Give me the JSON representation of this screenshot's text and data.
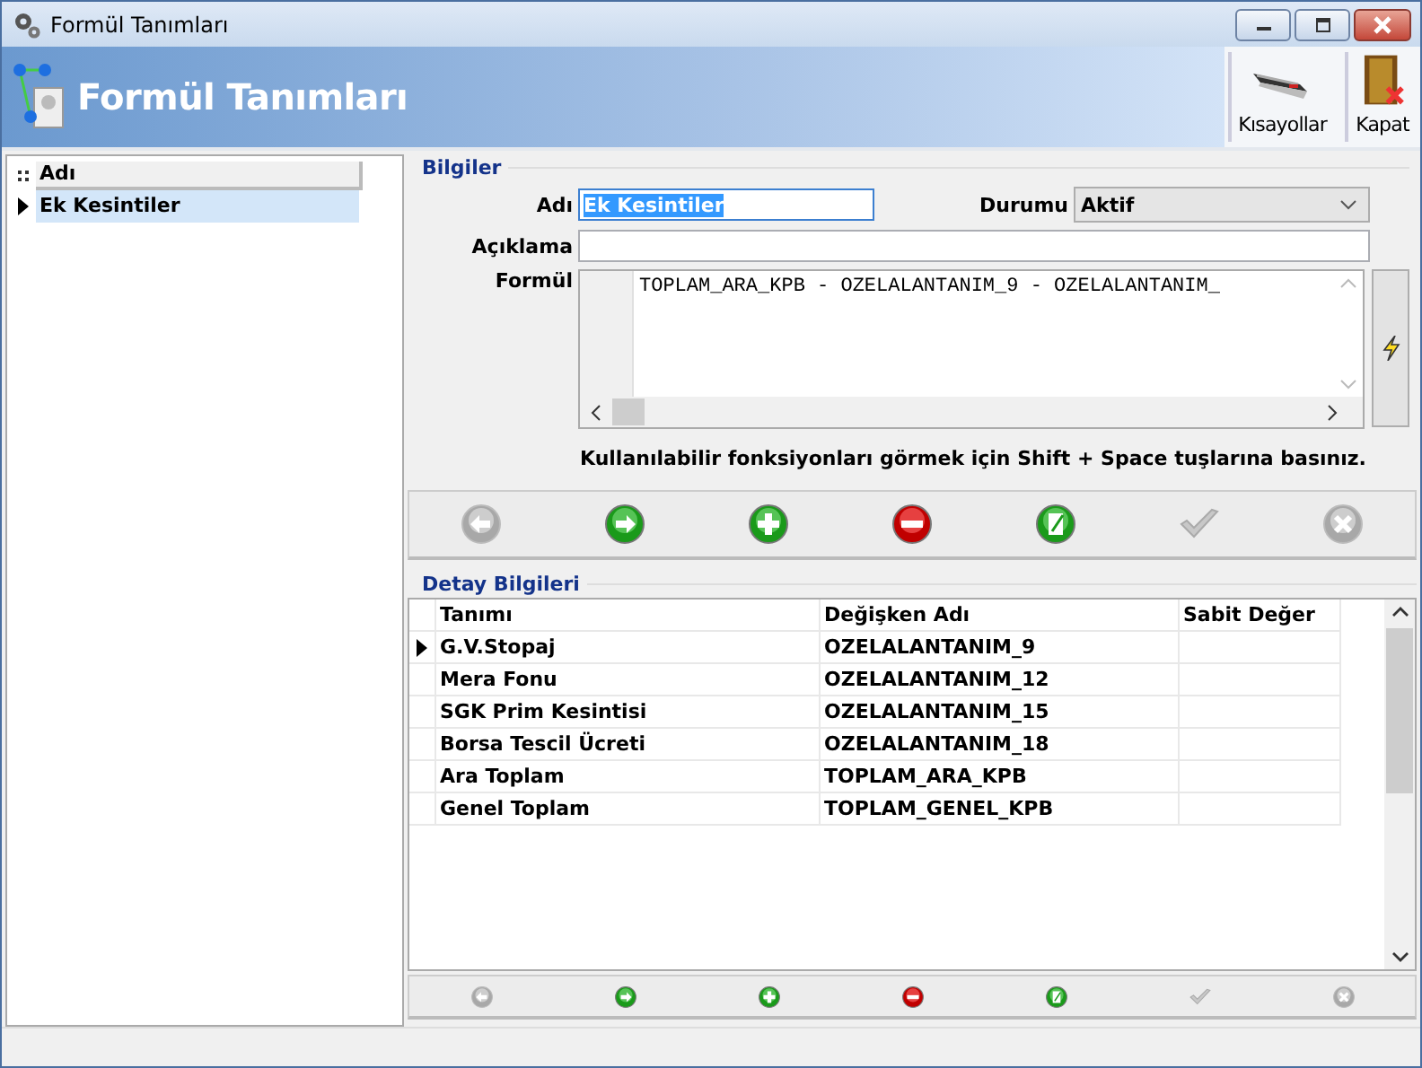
{
  "window": {
    "title": "Formül Tanımları"
  },
  "header": {
    "title": "Formül Tanımları",
    "buttons": [
      {
        "kind": "shortcuts",
        "label": "Kısayollar"
      },
      {
        "kind": "close",
        "label": "Kapat"
      }
    ]
  },
  "list": {
    "column": "Adı",
    "items": [
      {
        "label": "Ek Kesintiler",
        "selected": true
      }
    ]
  },
  "info": {
    "legend": "Bilgiler",
    "name_label": "Adı",
    "name_value": "Ek Kesintiler",
    "status_label": "Durumu",
    "status_value": "Aktif",
    "desc_label": "Açıklama",
    "formula_label": "Formül",
    "formula": "TOPLAM_ARA_KPB - OZELALANTANIM_9 - OZELALANTANIM_",
    "hint": "Kullanılabilir fonksiyonları görmek için Shift + Space tuşlarına basınız."
  },
  "toolbar": [
    {
      "kind": "prev",
      "disabled": true
    },
    {
      "kind": "next",
      "disabled": false
    },
    {
      "kind": "add",
      "disabled": false
    },
    {
      "kind": "delete",
      "disabled": false
    },
    {
      "kind": "edit",
      "disabled": false
    },
    {
      "kind": "confirm",
      "disabled": true
    },
    {
      "kind": "cancel",
      "disabled": true
    }
  ],
  "detail": {
    "legend": "Detay Bilgileri",
    "columns": [
      "Tanımı",
      "Değişken Adı",
      "Sabit Değer"
    ],
    "rows": [
      {
        "cells": [
          "G.V.Stopaj",
          "OZELALANTANIM_9",
          ""
        ],
        "selected": true
      },
      {
        "cells": [
          "Mera Fonu",
          "OZELALANTANIM_12",
          ""
        ],
        "selected": false
      },
      {
        "cells": [
          "SGK Prim Kesintisi",
          "OZELALANTANIM_15",
          ""
        ],
        "selected": false
      },
      {
        "cells": [
          "Borsa Tescil Ücreti",
          "OZELALANTANIM_18",
          ""
        ],
        "selected": false
      },
      {
        "cells": [
          "Ara Toplam",
          "TOPLAM_ARA_KPB",
          ""
        ],
        "selected": false
      },
      {
        "cells": [
          "Genel Toplam",
          "TOPLAM_GENEL_KPB",
          ""
        ],
        "selected": false
      }
    ]
  },
  "detail_toolbar": [
    {
      "kind": "prev",
      "disabled": true
    },
    {
      "kind": "next",
      "disabled": false
    },
    {
      "kind": "add",
      "disabled": false
    },
    {
      "kind": "delete",
      "disabled": false
    },
    {
      "kind": "edit",
      "disabled": false
    },
    {
      "kind": "confirm",
      "disabled": true
    },
    {
      "kind": "cancel",
      "disabled": true
    }
  ]
}
